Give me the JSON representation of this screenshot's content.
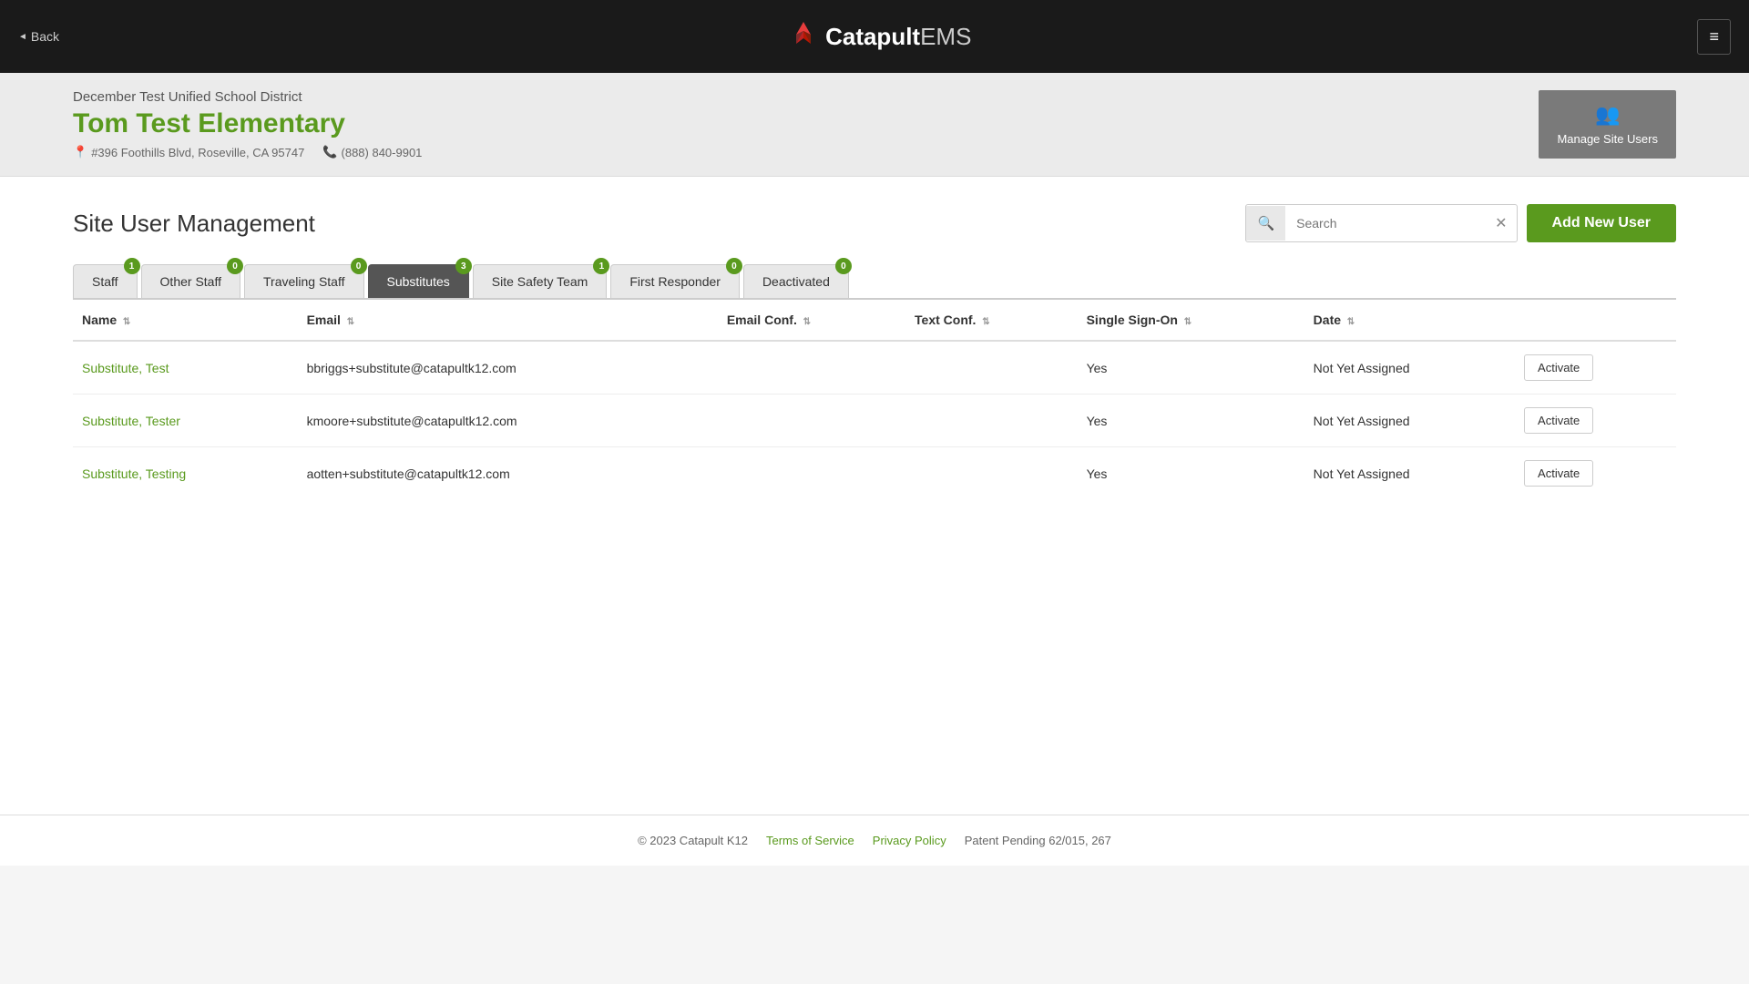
{
  "topbar": {
    "back_label": "Back",
    "logo_catapult": "Catapult",
    "logo_ems": "EMS",
    "hamburger_icon": "≡"
  },
  "school_header": {
    "district_name": "December Test Unified School District",
    "school_name": "Tom Test Elementary",
    "address": "#396 Foothills Blvd, Roseville, CA 95747",
    "phone": "(888) 840-9901",
    "manage_users_label": "Manage Site Users"
  },
  "page": {
    "title": "Site User Management",
    "search_placeholder": "Search",
    "add_user_label": "Add New User"
  },
  "tabs": [
    {
      "label": "Staff",
      "badge": "1",
      "active": false
    },
    {
      "label": "Other Staff",
      "badge": "0",
      "active": false
    },
    {
      "label": "Traveling Staff",
      "badge": "0",
      "active": false
    },
    {
      "label": "Substitutes",
      "badge": "3",
      "active": true
    },
    {
      "label": "Site Safety Team",
      "badge": "1",
      "active": false
    },
    {
      "label": "First Responder",
      "badge": "0",
      "active": false
    },
    {
      "label": "Deactivated",
      "badge": "0",
      "active": false
    }
  ],
  "table": {
    "columns": [
      {
        "label": "Name",
        "sortable": true
      },
      {
        "label": "Email",
        "sortable": true
      },
      {
        "label": "Email Conf.",
        "sortable": true
      },
      {
        "label": "Text Conf.",
        "sortable": true
      },
      {
        "label": "Single Sign-On",
        "sortable": true
      },
      {
        "label": "Date",
        "sortable": true
      },
      {
        "label": "",
        "sortable": false
      }
    ],
    "rows": [
      {
        "name": "Substitute, Test",
        "email": "bbriggs+substitute@catapultk12.com",
        "email_conf": "",
        "text_conf": "",
        "single_sign_on": "Yes",
        "date": "Not Yet Assigned",
        "action": "Activate"
      },
      {
        "name": "Substitute, Tester",
        "email": "kmoore+substitute@catapultk12.com",
        "email_conf": "",
        "text_conf": "",
        "single_sign_on": "Yes",
        "date": "Not Yet Assigned",
        "action": "Activate"
      },
      {
        "name": "Substitute, Testing",
        "email": "aotten+substitute@catapultk12.com",
        "email_conf": "",
        "text_conf": "",
        "single_sign_on": "Yes",
        "date": "Not Yet Assigned",
        "action": "Activate"
      }
    ]
  },
  "footer": {
    "copyright": "© 2023 Catapult K12",
    "terms_label": "Terms of Service",
    "privacy_label": "Privacy Policy",
    "patent": "Patent Pending 62/015, 267"
  }
}
